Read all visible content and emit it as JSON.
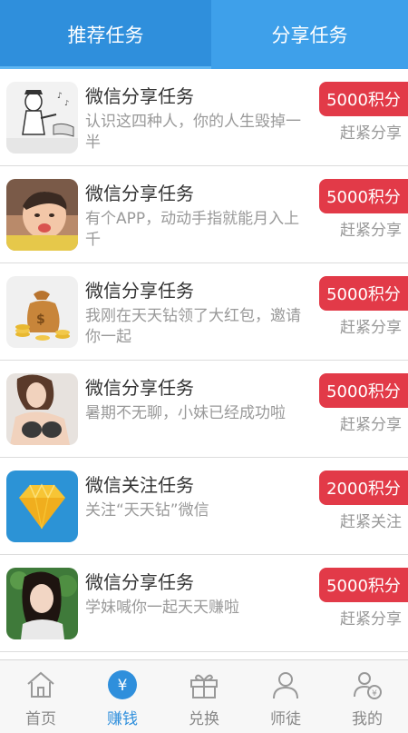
{
  "tabs": [
    {
      "label": "推荐任务"
    },
    {
      "label": "分享任务"
    }
  ],
  "tasks": [
    {
      "title": "微信分享任务",
      "desc": "认识这四种人，你的人生毁掉一半",
      "points": "5000积分",
      "action": "赶紧分享",
      "thumb": "cartoon-handshake-image"
    },
    {
      "title": "微信分享任务",
      "desc": "有个APP，动动手指就能月入上千",
      "points": "5000积分",
      "action": "赶紧分享",
      "thumb": "child-photo"
    },
    {
      "title": "微信分享任务",
      "desc": "我刚在天天钻领了大红包，邀请你一起",
      "points": "5000积分",
      "action": "赶紧分享",
      "thumb": "money-bag-icon"
    },
    {
      "title": "微信分享任务",
      "desc": "暑期不无聊，小妹已经成功啦",
      "points": "5000积分",
      "action": "赶紧分享",
      "thumb": "woman-photo"
    },
    {
      "title": "微信关注任务",
      "desc": "关注“天天钻”微信",
      "points": "2000积分",
      "action": "赶紧关注",
      "thumb": "diamond-logo"
    },
    {
      "title": "微信分享任务",
      "desc": "学妹喊你一起天天赚啦",
      "points": "5000积分",
      "action": "赶紧分享",
      "thumb": "girl-photo"
    }
  ],
  "bottom_nav": [
    {
      "label": "首页",
      "icon": "home-icon"
    },
    {
      "label": "赚钱",
      "icon": "yuan-coin-icon"
    },
    {
      "label": "兑换",
      "icon": "gift-icon"
    },
    {
      "label": "师徒",
      "icon": "people-icon"
    },
    {
      "label": "我的",
      "icon": "user-wallet-icon"
    }
  ],
  "colors": {
    "primary": "#2f8fdc",
    "tab_alt": "#3ea0ea",
    "badge_red": "#e23a48",
    "text_gray": "#999999"
  }
}
